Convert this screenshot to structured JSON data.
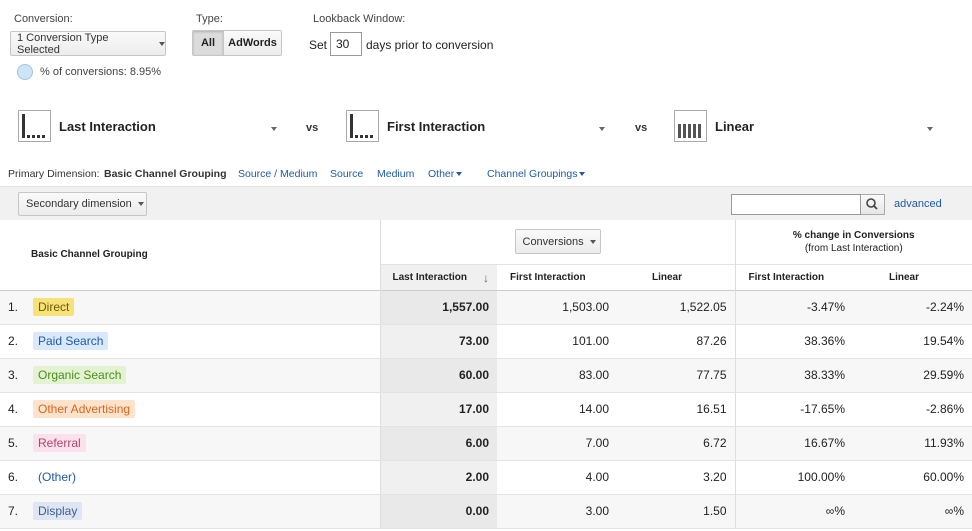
{
  "controls": {
    "conversion_label": "Conversion:",
    "conversion_select": "1 Conversion Type Selected",
    "pct_conversions": "% of conversions: 8.95%",
    "type_label": "Type:",
    "type_all": "All",
    "type_adwords": "AdWords",
    "lookback_label": "Lookback Window:",
    "set_label": "Set",
    "lookback_value": "30",
    "days_label": "days prior to conversion"
  },
  "models": [
    {
      "name": "Last Interaction",
      "icon": "last-interaction-model-icon"
    },
    {
      "name": "First Interaction",
      "icon": "first-interaction-model-icon"
    },
    {
      "name": "Linear",
      "icon": "linear-model-icon"
    }
  ],
  "vs_label": "vs",
  "dimension_bar": {
    "label": "Primary Dimension:",
    "active": "Basic Channel Grouping",
    "links": [
      "Source / Medium",
      "Source",
      "Medium",
      "Other"
    ],
    "channel_groupings": "Channel Groupings"
  },
  "toolbar": {
    "secondary_dimension": "Secondary dimension",
    "advanced": "advanced"
  },
  "table": {
    "dim_header": "Basic Channel Grouping",
    "metric_select": "Conversions",
    "pct_header_line1": "% change in Conversions",
    "pct_header_line2": "(from Last Interaction)",
    "col_headers": [
      "Last Interaction",
      "First Interaction",
      "Linear",
      "First Interaction",
      "Linear"
    ],
    "rows": [
      {
        "idx": "1.",
        "channel": "Direct",
        "color": "#f7e27a",
        "text": "#6b5a00",
        "li": "1,557.00",
        "fi": "1,503.00",
        "lin": "1,522.05",
        "pfi": "-3.47%",
        "plin": "-2.24%"
      },
      {
        "idx": "2.",
        "channel": "Paid Search",
        "color": "#d9e8fb",
        "text": "#1f5aa6",
        "li": "73.00",
        "fi": "101.00",
        "lin": "87.26",
        "pfi": "38.36%",
        "plin": "19.54%"
      },
      {
        "idx": "3.",
        "channel": "Organic Search",
        "color": "#e3f3d2",
        "text": "#4a8c1c",
        "li": "60.00",
        "fi": "83.00",
        "lin": "77.75",
        "pfi": "38.33%",
        "plin": "29.59%"
      },
      {
        "idx": "4.",
        "channel": "Other Advertising",
        "color": "#fde3cc",
        "text": "#d9661a",
        "li": "17.00",
        "fi": "14.00",
        "lin": "16.51",
        "pfi": "-17.65%",
        "plin": "-2.86%"
      },
      {
        "idx": "5.",
        "channel": "Referral",
        "color": "#fbe1ec",
        "text": "#b0456e",
        "li": "6.00",
        "fi": "7.00",
        "lin": "6.72",
        "pfi": "16.67%",
        "plin": "11.93%"
      },
      {
        "idx": "6.",
        "channel": "(Other)",
        "color": "transparent",
        "text": "#1f5aa6",
        "li": "2.00",
        "fi": "4.00",
        "lin": "3.20",
        "pfi": "100.00%",
        "plin": "60.00%"
      },
      {
        "idx": "7.",
        "channel": "Display",
        "color": "#dfe6f3",
        "text": "#3a5d96",
        "li": "0.00",
        "fi": "3.00",
        "lin": "1.50",
        "pfi": "∞%",
        "plin": "∞%"
      }
    ]
  }
}
